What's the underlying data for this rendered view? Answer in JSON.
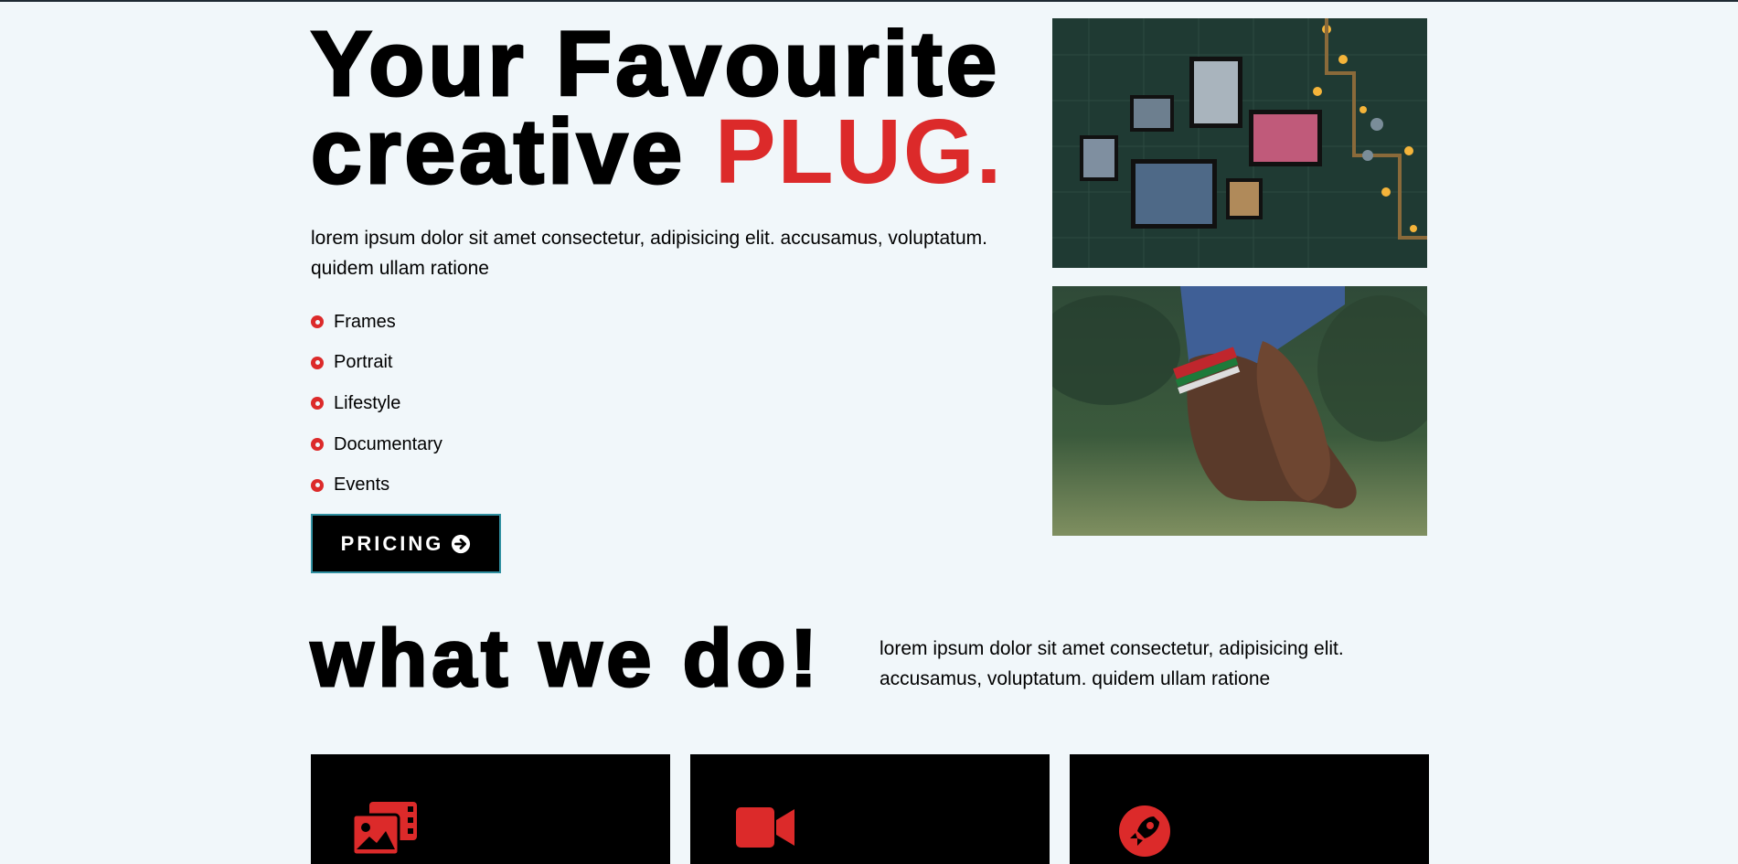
{
  "hero": {
    "title_line1": "Your Favourite",
    "title_line2_prefix": "creative ",
    "title_accent": "PLUG.",
    "text": "lorem ipsum dolor sit amet consectetur, adipisicing elit. accusamus, voluptatum. quidem ullam ratione",
    "services": [
      "Frames",
      "Portrait",
      "Lifestyle",
      "Documentary",
      "Events"
    ],
    "pricing_label": "PRICING"
  },
  "images": {
    "frames_alt": "picture frames on green wall",
    "hands_alt": "holding hands"
  },
  "section": {
    "title": "what we do!",
    "text": "lorem ipsum dolor sit amet consectetur, adipisicing elit. accusamus, voluptatum. quidem ullam ratione"
  },
  "cards": [
    {
      "icon": "images-icon"
    },
    {
      "icon": "video-camera-icon"
    },
    {
      "icon": "rocket-icon"
    }
  ],
  "colors": {
    "accent": "#dc2a2a",
    "background": "#f1f7fa",
    "dark": "#000000",
    "button_border": "#2f8fa0"
  }
}
